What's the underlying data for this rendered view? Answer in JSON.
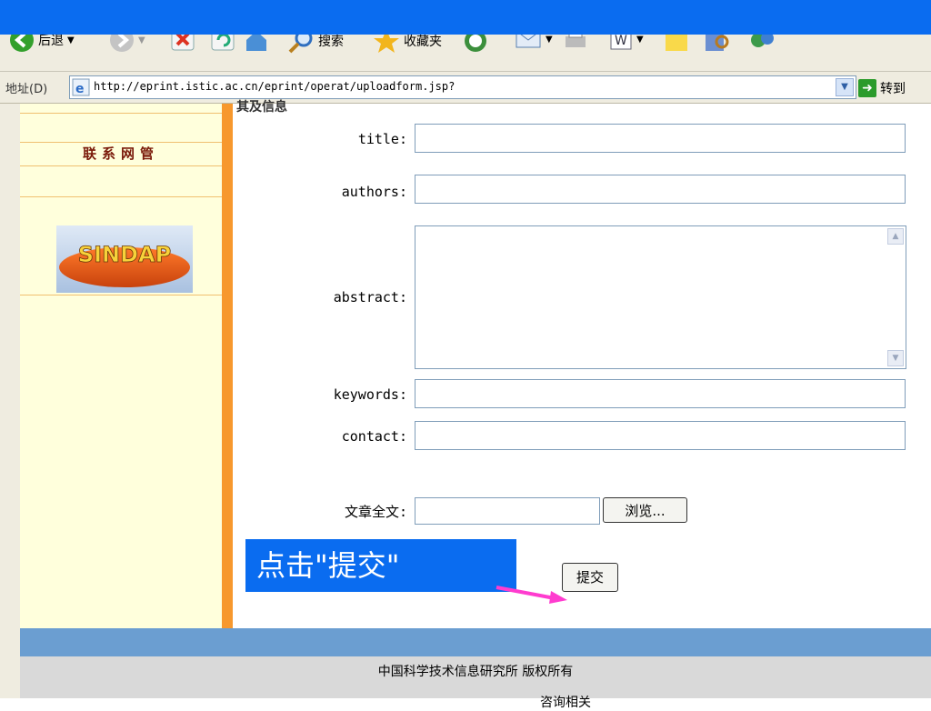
{
  "toolbar": {
    "back_label": "后退",
    "search_label": "搜索",
    "favorites_label": "收藏夹"
  },
  "address_bar": {
    "label": "地址(D)",
    "url": "http://eprint.istic.ac.cn/eprint/operat/uploadform.jsp?",
    "go_label": "转到"
  },
  "sidebar": {
    "contact_admin": "联系网管",
    "logo_text": "SINDAP"
  },
  "form": {
    "section_title_cut": "其及信息",
    "title_label": "title:",
    "authors_label": "authors:",
    "abstract_label": "abstract:",
    "keywords_label": "keywords:",
    "contact_label": "contact:",
    "fulltext_label": "文章全文:",
    "browse_label": "浏览...",
    "submit_label": "提交"
  },
  "callout": {
    "text": "点击\"提交\""
  },
  "footer": {
    "copyright": "中国科学技术信息研究所 版权所有",
    "partial": "咨询相关"
  },
  "colors": {
    "accent_blue": "#0a6cf0",
    "sidebar_bg": "#ffffdc",
    "sidebar_orange": "#f7982d",
    "footer_blue": "#6b9ed1",
    "arrow_pink": "#ff3ccf"
  }
}
